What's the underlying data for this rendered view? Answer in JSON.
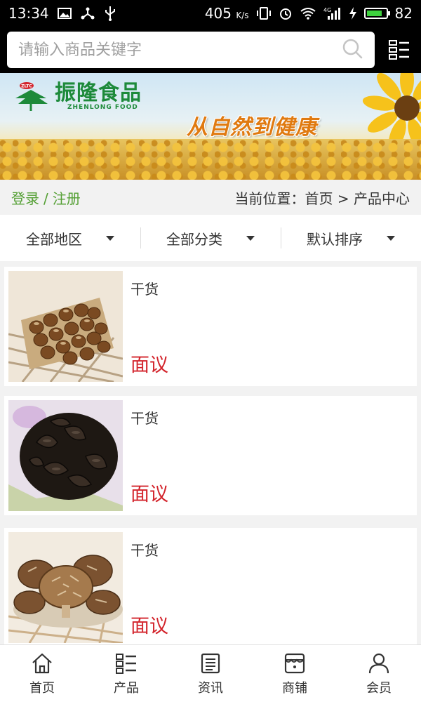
{
  "status_bar": {
    "time": "13:34",
    "speed": "405",
    "speed_unit": "K/s",
    "battery": "82",
    "battery_level": 0.82
  },
  "search": {
    "placeholder": "请输入商品关键字"
  },
  "banner": {
    "logo_badge": "ZLTC",
    "logo_cn": "振隆食品",
    "logo_en": "ZHENLONG FOOD",
    "slogan": "从自然到健康"
  },
  "breadcrumb": {
    "login": "登录",
    "separator": "/",
    "register": "注册",
    "location": "当前位置：首页 > 产品中心"
  },
  "filters": [
    {
      "label": "全部地区"
    },
    {
      "label": "全部分类"
    },
    {
      "label": "默认排序"
    }
  ],
  "products": [
    {
      "title": "干货",
      "price": "面议",
      "image": "hazelnuts"
    },
    {
      "title": "干货",
      "price": "面议",
      "image": "black-fungus"
    },
    {
      "title": "干货",
      "price": "面议",
      "image": "shiitake-mushrooms"
    }
  ],
  "tabbar": [
    {
      "label": "首页",
      "icon": "home-icon"
    },
    {
      "label": "产品",
      "icon": "grid-list-icon"
    },
    {
      "label": "资讯",
      "icon": "news-icon"
    },
    {
      "label": "商铺",
      "icon": "store-icon"
    },
    {
      "label": "会员",
      "icon": "user-icon"
    }
  ],
  "colors": {
    "accent_green": "#55a035",
    "price_red": "#d3242c"
  }
}
